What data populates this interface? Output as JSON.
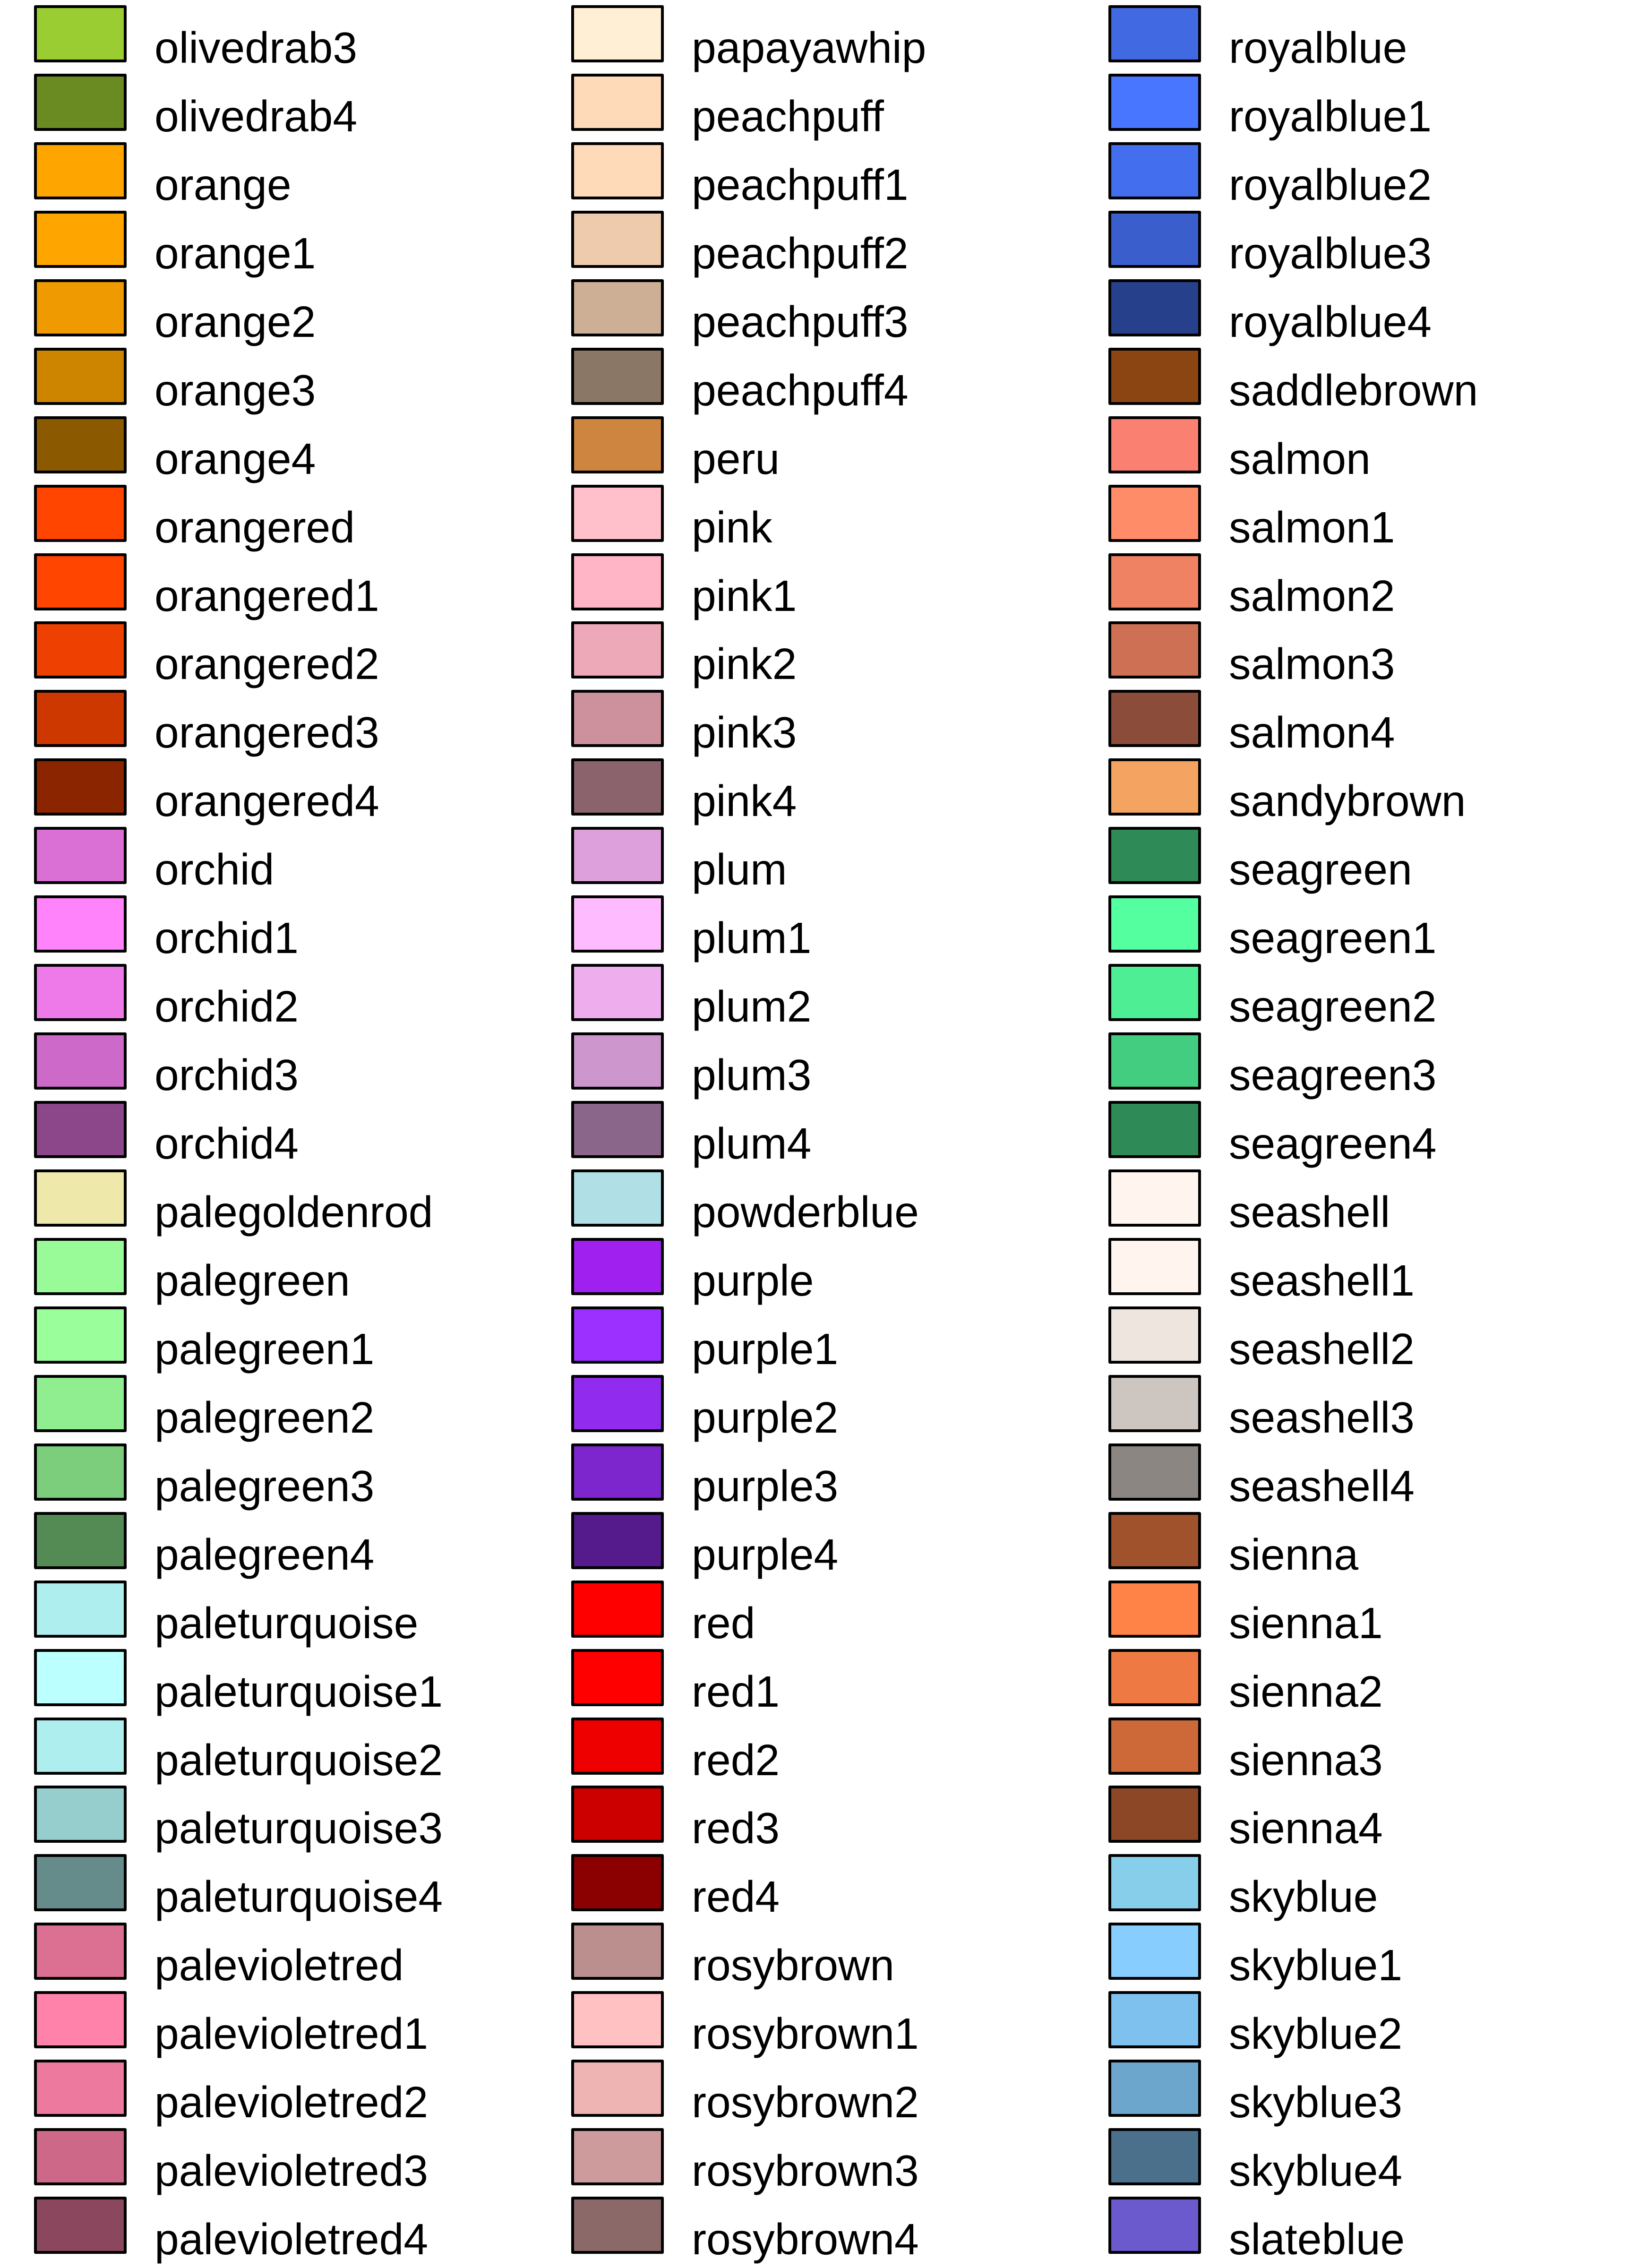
{
  "columns": [
    {
      "items": [
        {
          "name": "olivedrab3",
          "color": "#9ACD32"
        },
        {
          "name": "olivedrab4",
          "color": "#698B22"
        },
        {
          "name": "orange",
          "color": "#FFA500"
        },
        {
          "name": "orange1",
          "color": "#FFA500"
        },
        {
          "name": "orange2",
          "color": "#EE9A00"
        },
        {
          "name": "orange3",
          "color": "#CD8500"
        },
        {
          "name": "orange4",
          "color": "#8B5A00"
        },
        {
          "name": "orangered",
          "color": "#FF4500"
        },
        {
          "name": "orangered1",
          "color": "#FF4500"
        },
        {
          "name": "orangered2",
          "color": "#EE4000"
        },
        {
          "name": "orangered3",
          "color": "#CD3700"
        },
        {
          "name": "orangered4",
          "color": "#8B2500"
        },
        {
          "name": "orchid",
          "color": "#DA70D6"
        },
        {
          "name": "orchid1",
          "color": "#FF83FA"
        },
        {
          "name": "orchid2",
          "color": "#EE7AE9"
        },
        {
          "name": "orchid3",
          "color": "#CD69C9"
        },
        {
          "name": "orchid4",
          "color": "#8B4789"
        },
        {
          "name": "palegoldenrod",
          "color": "#EEE8AA"
        },
        {
          "name": "palegreen",
          "color": "#98FB98"
        },
        {
          "name": "palegreen1",
          "color": "#9AFF9A"
        },
        {
          "name": "palegreen2",
          "color": "#90EE90"
        },
        {
          "name": "palegreen3",
          "color": "#7CCD7C"
        },
        {
          "name": "palegreen4",
          "color": "#548B54"
        },
        {
          "name": "paleturquoise",
          "color": "#AFEEEE"
        },
        {
          "name": "paleturquoise1",
          "color": "#BBFFFF"
        },
        {
          "name": "paleturquoise2",
          "color": "#AEEEEE"
        },
        {
          "name": "paleturquoise3",
          "color": "#96CDCD"
        },
        {
          "name": "paleturquoise4",
          "color": "#668B8B"
        },
        {
          "name": "palevioletred",
          "color": "#DB7093"
        },
        {
          "name": "palevioletred1",
          "color": "#FF82AB"
        },
        {
          "name": "palevioletred2",
          "color": "#EE799F"
        },
        {
          "name": "palevioletred3",
          "color": "#CD6889"
        },
        {
          "name": "palevioletred4",
          "color": "#8B475D"
        }
      ]
    },
    {
      "items": [
        {
          "name": "papayawhip",
          "color": "#FFEFD5"
        },
        {
          "name": "peachpuff",
          "color": "#FFDAB9"
        },
        {
          "name": "peachpuff1",
          "color": "#FFDAB9"
        },
        {
          "name": "peachpuff2",
          "color": "#EECBAD"
        },
        {
          "name": "peachpuff3",
          "color": "#CDAF95"
        },
        {
          "name": "peachpuff4",
          "color": "#8B7765"
        },
        {
          "name": "peru",
          "color": "#CD853F"
        },
        {
          "name": "pink",
          "color": "#FFC0CB"
        },
        {
          "name": "pink1",
          "color": "#FFB5C5"
        },
        {
          "name": "pink2",
          "color": "#EEA9B8"
        },
        {
          "name": "pink3",
          "color": "#CD919E"
        },
        {
          "name": "pink4",
          "color": "#8B636C"
        },
        {
          "name": "plum",
          "color": "#DDA0DD"
        },
        {
          "name": "plum1",
          "color": "#FFBBFF"
        },
        {
          "name": "plum2",
          "color": "#EEAEEE"
        },
        {
          "name": "plum3",
          "color": "#CD96CD"
        },
        {
          "name": "plum4",
          "color": "#8B668B"
        },
        {
          "name": "powderblue",
          "color": "#B0E0E6"
        },
        {
          "name": "purple",
          "color": "#A020F0"
        },
        {
          "name": "purple1",
          "color": "#9B30FF"
        },
        {
          "name": "purple2",
          "color": "#912CEE"
        },
        {
          "name": "purple3",
          "color": "#7D26CD"
        },
        {
          "name": "purple4",
          "color": "#551A8B"
        },
        {
          "name": "red",
          "color": "#FF0000"
        },
        {
          "name": "red1",
          "color": "#FF0000"
        },
        {
          "name": "red2",
          "color": "#EE0000"
        },
        {
          "name": "red3",
          "color": "#CD0000"
        },
        {
          "name": "red4",
          "color": "#8B0000"
        },
        {
          "name": "rosybrown",
          "color": "#BC8F8F"
        },
        {
          "name": "rosybrown1",
          "color": "#FFC1C1"
        },
        {
          "name": "rosybrown2",
          "color": "#EEB4B4"
        },
        {
          "name": "rosybrown3",
          "color": "#CD9B9B"
        },
        {
          "name": "rosybrown4",
          "color": "#8B6969"
        }
      ]
    },
    {
      "items": [
        {
          "name": "royalblue",
          "color": "#4169E1"
        },
        {
          "name": "royalblue1",
          "color": "#4876FF"
        },
        {
          "name": "royalblue2",
          "color": "#436EEE"
        },
        {
          "name": "royalblue3",
          "color": "#3A5FCD"
        },
        {
          "name": "royalblue4",
          "color": "#27408B"
        },
        {
          "name": "saddlebrown",
          "color": "#8B4513"
        },
        {
          "name": "salmon",
          "color": "#FA8072"
        },
        {
          "name": "salmon1",
          "color": "#FF8C69"
        },
        {
          "name": "salmon2",
          "color": "#EE8262"
        },
        {
          "name": "salmon3",
          "color": "#CD7054"
        },
        {
          "name": "salmon4",
          "color": "#8B4C39"
        },
        {
          "name": "sandybrown",
          "color": "#F4A460"
        },
        {
          "name": "seagreen",
          "color": "#2E8B57"
        },
        {
          "name": "seagreen1",
          "color": "#54FF9F"
        },
        {
          "name": "seagreen2",
          "color": "#4EEE94"
        },
        {
          "name": "seagreen3",
          "color": "#43CD80"
        },
        {
          "name": "seagreen4",
          "color": "#2E8B57"
        },
        {
          "name": "seashell",
          "color": "#FFF5EE"
        },
        {
          "name": "seashell1",
          "color": "#FFF5EE"
        },
        {
          "name": "seashell2",
          "color": "#EEE5DE"
        },
        {
          "name": "seashell3",
          "color": "#CDC5BF"
        },
        {
          "name": "seashell4",
          "color": "#8B8682"
        },
        {
          "name": "sienna",
          "color": "#A0522D"
        },
        {
          "name": "sienna1",
          "color": "#FF8247"
        },
        {
          "name": "sienna2",
          "color": "#EE7942"
        },
        {
          "name": "sienna3",
          "color": "#CD6839"
        },
        {
          "name": "sienna4",
          "color": "#8B4726"
        },
        {
          "name": "skyblue",
          "color": "#87CEEB"
        },
        {
          "name": "skyblue1",
          "color": "#87CEFF"
        },
        {
          "name": "skyblue2",
          "color": "#7EC0EE"
        },
        {
          "name": "skyblue3",
          "color": "#6CA6CD"
        },
        {
          "name": "skyblue4",
          "color": "#4A708B"
        },
        {
          "name": "slateblue",
          "color": "#6A5ACD"
        }
      ]
    }
  ]
}
